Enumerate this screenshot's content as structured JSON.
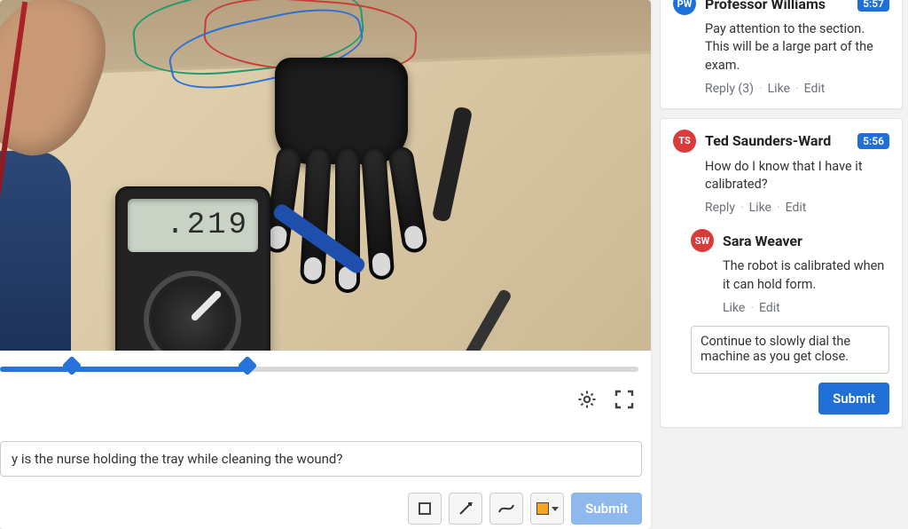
{
  "video": {
    "multimeter_reading": ".219",
    "progress_percent": 38,
    "markers": [
      11,
      38
    ]
  },
  "question": {
    "placeholder": "y is the nurse holding the tray while cleaning the wound?",
    "submit_label": "Submit"
  },
  "comments": [
    {
      "initials": "PW",
      "avatar_color": "#1f6fd6",
      "name": "Professor Williams",
      "timestamp": "5:57",
      "body": "Pay attention to the section. This will be a large part of the exam.",
      "reply_label": "Reply (3)",
      "like_label": "Like",
      "edit_label": "Edit"
    },
    {
      "initials": "TS",
      "avatar_color": "#d93b3b",
      "name": "Ted Saunders-Ward",
      "timestamp": "5:56",
      "body": "How do I know that I have it calibrated?",
      "reply_label": "Reply",
      "like_label": "Like",
      "edit_label": "Edit",
      "reply": {
        "initials": "SW",
        "avatar_color": "#d93b3b",
        "name": "Sara Weaver",
        "body": "The robot is calibrated when it can hold form.",
        "like_label": "Like",
        "edit_label": "Edit"
      },
      "draft": "Continue to slowly dial the machine as you get close.",
      "submit_label": "Submit"
    }
  ],
  "icons": {
    "settings": "gear",
    "fullscreen": "fullscreen",
    "tool_square": "square",
    "tool_pointer": "pointer",
    "tool_curve": "curve",
    "tool_color": "color-swatch"
  }
}
